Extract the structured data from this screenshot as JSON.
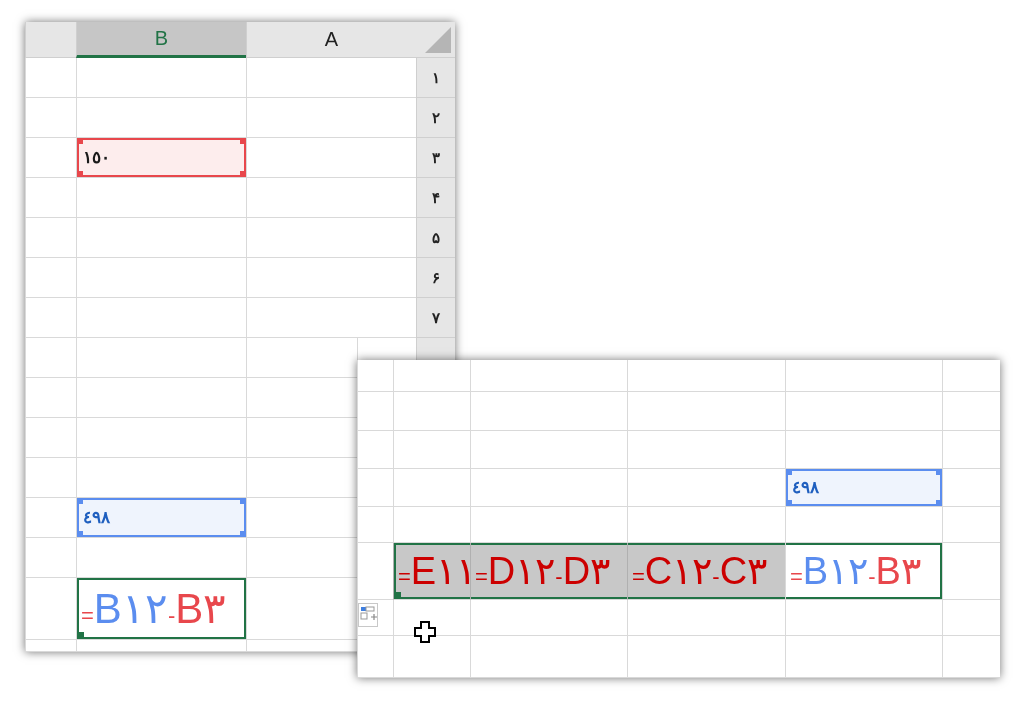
{
  "windows": [
    {
      "columns": [
        {
          "label": "A",
          "selected": false
        },
        {
          "label": "B",
          "selected": true
        }
      ],
      "rows": [
        {
          "header": "۱"
        },
        {
          "header": "۲"
        },
        {
          "header": "۳",
          "cell": {
            "kind": "input",
            "text": "١٥٠",
            "color": "#e8474c"
          }
        },
        {
          "header": "۴"
        },
        {
          "header": "۵"
        },
        {
          "header": "۶"
        },
        {
          "header": "۷"
        },
        {},
        {},
        {},
        {},
        {
          "cell": {
            "kind": "result",
            "text": "٤٩٨",
            "color": "#5b8def"
          }
        },
        {},
        {
          "cell": {
            "kind": "formula",
            "selected": true,
            "shaded": false,
            "parts": [
              {
                "kind": "ref",
                "text": "B۳",
                "color": "#e8474c"
              },
              {
                "kind": "op",
                "text": "-",
                "color": "#e8474c"
              },
              {
                "kind": "ref",
                "text": "B۱۲",
                "color": "#5b8def"
              },
              {
                "kind": "op",
                "text": "=",
                "color": "#e8474c"
              }
            ]
          }
        },
        {}
      ]
    },
    {
      "rows": [
        {},
        {},
        {},
        {
          "cells": [
            {},
            {
              "kind": "result",
              "text": "٤٩٨",
              "color": "#5b8def"
            },
            {},
            {},
            {},
            {}
          ]
        },
        {},
        {
          "cells": [
            {},
            {
              "kind": "formula",
              "selected": true,
              "shaded": false,
              "parts": [
                {
                  "kind": "ref",
                  "text": "B۳",
                  "color": "#e8474c"
                },
                {
                  "kind": "op",
                  "text": "-",
                  "color": "#e8474c"
                },
                {
                  "kind": "ref",
                  "text": "B۱۲",
                  "color": "#5b8def"
                },
                {
                  "kind": "op",
                  "text": "=",
                  "color": "#e8474c"
                }
              ]
            },
            {
              "kind": "formula",
              "selected": true,
              "shaded": true,
              "parts": [
                {
                  "kind": "ref",
                  "text": "C۳",
                  "color": "#cc0000"
                },
                {
                  "kind": "op",
                  "text": "-",
                  "color": "#cc0000"
                },
                {
                  "kind": "ref",
                  "text": "C۱۲",
                  "color": "#cc0000"
                },
                {
                  "kind": "op",
                  "text": "=",
                  "color": "#cc0000"
                }
              ]
            },
            {
              "kind": "formula",
              "selected": true,
              "shaded": true,
              "parts": [
                {
                  "kind": "ref",
                  "text": "D۳",
                  "color": "#cc0000"
                },
                {
                  "kind": "op",
                  "text": "-",
                  "color": "#cc0000"
                },
                {
                  "kind": "ref",
                  "text": "D۱۲",
                  "color": "#cc0000"
                },
                {
                  "kind": "op",
                  "text": "=",
                  "color": "#cc0000"
                }
              ]
            },
            {
              "kind": "formula",
              "selected": true,
              "shaded": true,
              "parts": [
                {
                  "kind": "ref",
                  "text": "E۱۱",
                  "color": "#cc0000"
                },
                {
                  "kind": "op",
                  "text": "=",
                  "color": "#cc0000"
                }
              ]
            },
            {}
          ]
        },
        {},
        {}
      ]
    }
  ]
}
